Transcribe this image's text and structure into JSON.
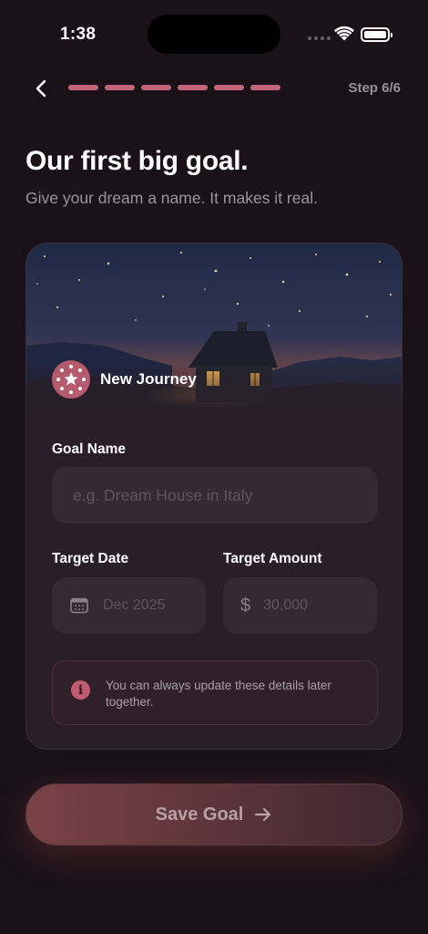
{
  "status_bar": {
    "time": "1:38"
  },
  "header": {
    "step_label": "Step 6/6",
    "progress": {
      "completed": 6,
      "total": 6
    }
  },
  "page": {
    "title": "Our first big goal.",
    "subtitle": "Give your dream a name. It makes it real."
  },
  "card": {
    "badge_label": "New Journey",
    "goal_name": {
      "label": "Goal Name",
      "placeholder": "e.g. Dream House in Italy",
      "value": ""
    },
    "target_date": {
      "label": "Target Date",
      "placeholder": "Dec 2025",
      "value": ""
    },
    "target_amount": {
      "label": "Target Amount",
      "currency_symbol": "$",
      "placeholder": "30,000",
      "value": ""
    },
    "info_text": "You can always update these details later together."
  },
  "save_button": {
    "label": "Save Goal",
    "icon": "arrow-right-icon"
  },
  "colors": {
    "background": "#1b1219",
    "card": "#2a1f28",
    "field": "#352a34",
    "accent": "#c4667a"
  }
}
